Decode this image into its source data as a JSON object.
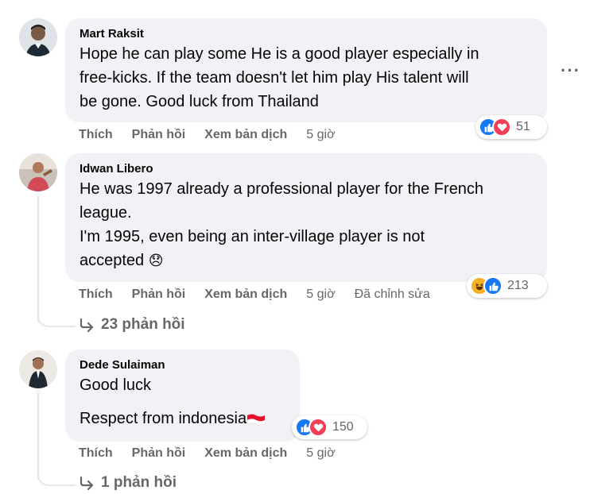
{
  "comments": [
    {
      "author": "Mart Raksit",
      "lines": [
        "Hope he can play some He is a good player especially in",
        "free-kicks. If the team doesn't let him play His talent will",
        "be gone. Good luck from Thailand"
      ],
      "actions": {
        "like": "Thích",
        "reply": "Phản hồi",
        "translate": "Xem bản dịch",
        "time": "5 giờ"
      },
      "reactions": {
        "icons": [
          "like-icon",
          "love-icon"
        ],
        "count": "51"
      }
    },
    {
      "author": "Idwan Libero",
      "lines": [
        "He was 1997 already a professional player for the French",
        "league.",
        "I'm 1995, even being an inter-village player is not",
        "accepted"
      ],
      "emoji": "😞",
      "actions": {
        "like": "Thích",
        "reply": "Phản hồi",
        "translate": "Xem bản dịch",
        "time": "5 giờ",
        "edited": "Đã chỉnh sửa"
      },
      "reactions": {
        "icons": [
          "haha-icon",
          "like-icon"
        ],
        "count": "213"
      },
      "replies": "23 phản hồi"
    },
    {
      "author": "Dede Sulaiman",
      "lines": [
        "Good luck",
        "Respect from indonesia"
      ],
      "flag": "indonesia-flag-icon",
      "actions": {
        "like": "Thích",
        "reply": "Phản hồi",
        "translate": "Xem bản dịch",
        "time": "5 giờ"
      },
      "reactions": {
        "icons": [
          "like-icon",
          "love-icon"
        ],
        "count": "150"
      },
      "replies": "1 phản hồi"
    }
  ],
  "colors": {
    "bubble": "#f0f2f5",
    "meta": "#65676b",
    "like": "#1877f2",
    "love": "#f33e58",
    "haha": "#f7b125"
  }
}
